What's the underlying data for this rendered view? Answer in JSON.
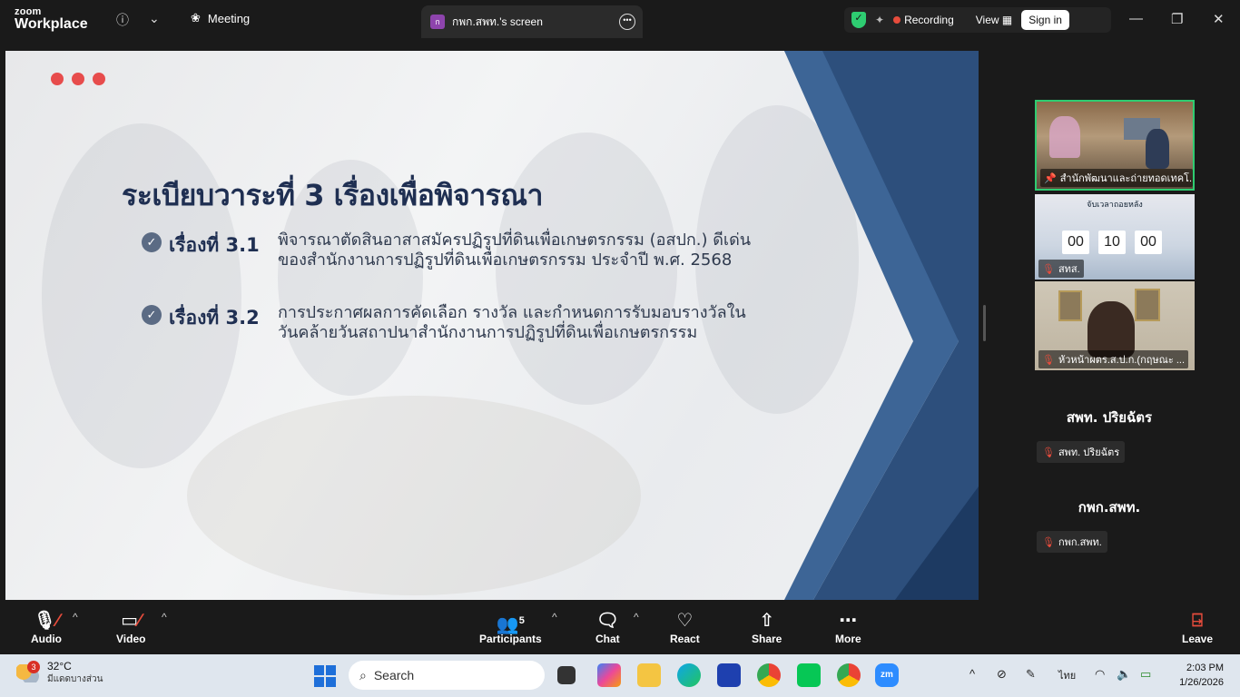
{
  "titlebar": {
    "brand_line1": "zoom",
    "brand_line2": "Workplace",
    "meeting_label": "Meeting",
    "screen_tab_initial": "ก",
    "screen_tab_label": "กพก.สพท.'s screen",
    "recording_label": "Recording",
    "view_label": "View",
    "sign_in_label": "Sign in"
  },
  "slide": {
    "title": "ระเบียบวาระที่ 3  เรื่องเพื่อพิจารณา",
    "items": [
      {
        "label": "เรื่องที่ 3.1",
        "line1": "พิจารณาตัดสินอาสาสมัครปฏิรูปที่ดินเพื่อเกษตรกรรม (อสปก.) ดีเด่น",
        "line2": "ของสำนักงานการปฏิรูปที่ดินเพื่อเกษตรกรรม ประจำปี พ.ศ. 2568"
      },
      {
        "label": "เรื่องที่ 3.2",
        "line1": "การประกาศผลการคัดเลือก รางวัล และกำหนดการรับมอบรางวัลใน",
        "line2": "วันคล้ายวันสถาปนาสำนักงานการปฏิรูปที่ดินเพื่อเกษตรกรรม"
      }
    ]
  },
  "gallery": {
    "tiles": [
      {
        "name": "สำนักพัฒนาและถ่ายทอดเทคโ..."
      },
      {
        "name": "สทส."
      },
      {
        "name": "หัวหน้าผตร.ส.ป.ก.(กฤษณะ ..."
      }
    ],
    "timer": {
      "heading": "จับเวลาถอยหลัง",
      "hh": "00",
      "mm": "10",
      "ss": "00"
    },
    "names": [
      {
        "big": "สพท. ปริยฉัตร",
        "small": "สพท. ปริยฉัตร"
      },
      {
        "big": "กพก.สพท.",
        "small": "กพก.สพท."
      }
    ]
  },
  "toolbar": {
    "audio": "Audio",
    "video": "Video",
    "participants": "Participants",
    "participants_count": "5",
    "chat": "Chat",
    "react": "React",
    "share": "Share",
    "more": "More",
    "leave": "Leave"
  },
  "taskbar": {
    "weather_temp": "32°C",
    "weather_desc": "มีแดดบางส่วน",
    "weather_badge": "3",
    "search_placeholder": "Search",
    "lang": "ไทย",
    "time": "2:03 PM",
    "date": "1/26/2026"
  }
}
